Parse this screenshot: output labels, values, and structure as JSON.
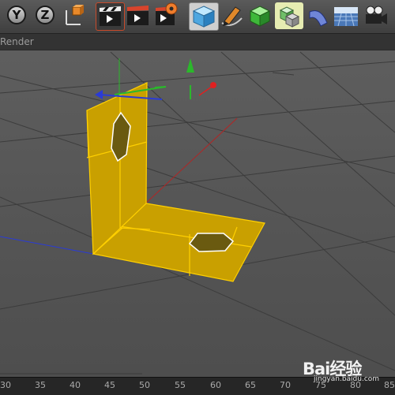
{
  "toolbar": {
    "buttons": [
      {
        "name": "y-axis-lock-button",
        "glyph": "Y"
      },
      {
        "name": "z-axis-lock-button",
        "glyph": "Z"
      },
      {
        "name": "coordinate-system-button",
        "icon": "coordinate-axes-icon"
      },
      {
        "name": "render-view-button",
        "icon": "clapper-play-icon"
      },
      {
        "name": "render-to-picture-viewer-button",
        "icon": "clapper-play-icon"
      },
      {
        "name": "render-settings-button",
        "icon": "clapper-gear-icon"
      },
      {
        "name": "cube-primitive-button",
        "icon": "cube-icon"
      },
      {
        "name": "pen-spline-button",
        "icon": "pen-icon"
      },
      {
        "name": "subdivision-surface-button",
        "icon": "green-cube-icon"
      },
      {
        "name": "array-generator-button",
        "icon": "cloner-icon"
      },
      {
        "name": "deformer-button",
        "icon": "bend-icon"
      },
      {
        "name": "floor-environment-button",
        "icon": "grid-plane-icon"
      },
      {
        "name": "camera-button",
        "icon": "camera-icon"
      }
    ]
  },
  "menubar": {
    "label": "Render"
  },
  "viewport": {
    "mesh_color": "#c9a000",
    "edge_color": "#ffd000",
    "axis_colors": {
      "x": "#d22828",
      "y": "#2bb82b",
      "z": "#2a3bd6"
    }
  },
  "ruler": {
    "ticks": [
      "30",
      "35",
      "40",
      "45",
      "50",
      "55",
      "60",
      "65",
      "70",
      "75",
      "80",
      "85"
    ]
  },
  "watermark": {
    "brand": "Bai经验",
    "url": "jingyan.baidu.com"
  }
}
